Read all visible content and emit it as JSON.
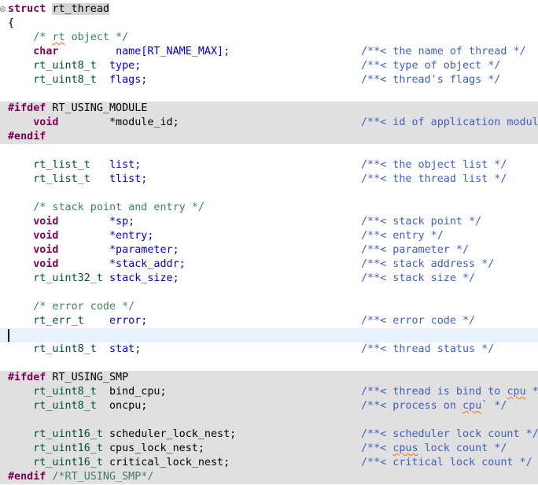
{
  "editor": {
    "struct_keyword": "struct",
    "struct_name": "rt_thread",
    "open_brace": "{",
    "lines": {
      "c_rt_object": {
        "pre": "/* ",
        "word": "rt",
        "post": " object */"
      },
      "name": {
        "type": "char",
        "pad": "         ",
        "field": "name[RT_NAME_MAX];",
        "comment": "/**< the name of thread */"
      },
      "type": {
        "type": "rt_uint8_t",
        "pad": "  ",
        "field": "type;",
        "comment": "/**< type of object */"
      },
      "flags": {
        "type": "rt_uint8_t",
        "pad": "  ",
        "field": "flags;",
        "comment": "/**< thread's flags */"
      },
      "ifdef_module": {
        "directive": "#ifdef",
        "macro": " RT_USING_MODULE"
      },
      "module_id": {
        "type": "void",
        "pad": "        ",
        "field": "*module_id;",
        "comment": "/**< id of application module */"
      },
      "endif_module": {
        "directive": "#endif"
      },
      "list": {
        "type": "rt_list_t",
        "pad": "   ",
        "field": "list;",
        "comment": "/**< the object list */"
      },
      "tlist": {
        "type": "rt_list_t",
        "pad": "   ",
        "field": "tlist;",
        "comment": "/**< the thread list */"
      },
      "c_stack": {
        "text": "/* stack point and entry */"
      },
      "sp": {
        "type": "void",
        "pad": "        ",
        "field": "*sp;",
        "comment": "/**< stack point */"
      },
      "entry": {
        "type": "void",
        "pad": "        ",
        "field": "*entry;",
        "comment": "/**< entry */"
      },
      "parameter": {
        "type": "void",
        "pad": "        ",
        "field": "*parameter;",
        "comment": "/**< parameter */"
      },
      "stack_addr": {
        "type": "void",
        "pad": "        ",
        "field": "*stack_addr;",
        "comment": "/**< stack address */"
      },
      "stack_size": {
        "type": "rt_uint32_t",
        "pad": " ",
        "field": "stack_size;",
        "comment": "/**< stack size */"
      },
      "c_error": {
        "text": "/* error code */"
      },
      "error": {
        "type": "rt_err_t",
        "pad": "    ",
        "field": "error;",
        "comment": "/**< error code */"
      },
      "stat": {
        "type": "rt_uint8_t",
        "pad": "  ",
        "field": "stat;",
        "comment": "/**< thread status */"
      },
      "ifdef_smp": {
        "directive": "#ifdef",
        "macro": " RT_USING_SMP"
      },
      "bind_cpu": {
        "type": "rt_uint8_t",
        "pad": "  ",
        "field": "bind_cpu;",
        "comment_pre": "/**< thread is bind to ",
        "comment_word": "cpu",
        "comment_post": " */"
      },
      "oncpu": {
        "type": "rt_uint8_t",
        "pad": "  ",
        "field": "oncpu;",
        "comment_pre": "/**< process on ",
        "comment_word": "cpu",
        "comment_post": "` */"
      },
      "sched_lock": {
        "type": "rt_uint16_t",
        "pad": " ",
        "field": "scheduler_lock_nest;",
        "comment": "/**< scheduler lock count */"
      },
      "cpus_lock": {
        "type": "rt_uint16_t",
        "pad": " ",
        "field": "cpus_lock_nest;",
        "comment_pre": "/**< ",
        "comment_word": "cpus",
        "comment_post": " lock count */"
      },
      "crit_lock": {
        "type": "rt_uint16_t",
        "pad": " ",
        "field": "critical_lock_nest;",
        "comment": "/**< critical lock count */"
      },
      "endif_smp": {
        "directive": "#endif",
        "comment": " /*RT_USING_SMP*/"
      }
    }
  },
  "colors": {
    "keyword": "#7f0055",
    "type": "#005032",
    "field": "#0000c0",
    "comment": "#3f7f5f",
    "doc_comment": "#3f5fbf",
    "inactive_bg": "#e0e0e0",
    "current_line_bg": "#e8f2fe"
  }
}
